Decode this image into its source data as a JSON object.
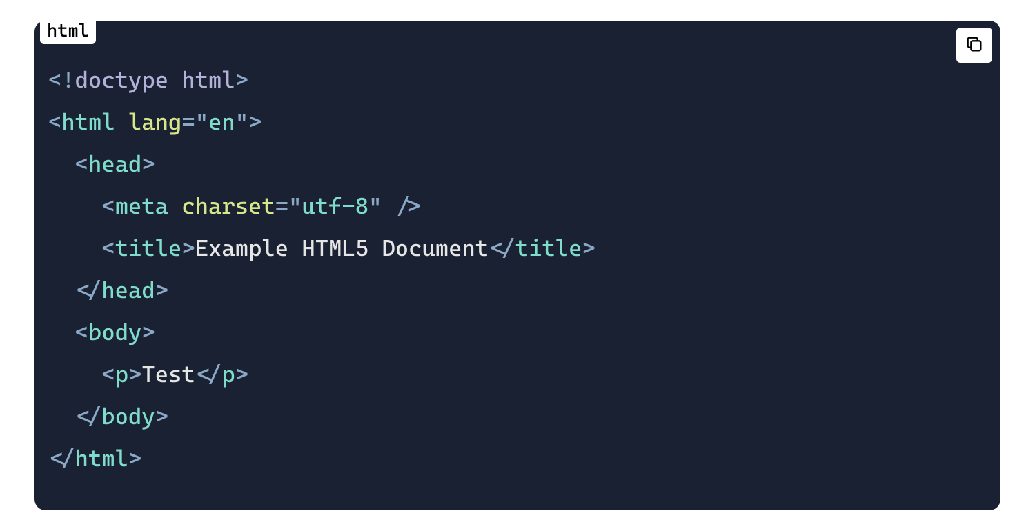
{
  "badge_label": "html",
  "code": {
    "line1": {
      "p1": "<!",
      "doctype": "doctype html",
      "p2": ">"
    },
    "line2": {
      "p1": "<",
      "tag": "html",
      "sp": " ",
      "attr": "lang",
      "eq": "=",
      "q1": "\"",
      "val": "en",
      "q2": "\"",
      "p2": ">"
    },
    "line3": {
      "indent": "  ",
      "p1": "<",
      "tag": "head",
      "p2": ">"
    },
    "line4": {
      "indent": "    ",
      "p1": "<",
      "tag": "meta",
      "sp": " ",
      "attr": "charset",
      "eq": "=",
      "q1": "\"",
      "val": "utf-8",
      "q2": "\"",
      "sp2": " ",
      "p2": "/>"
    },
    "line5": {
      "indent": "    ",
      "p1": "<",
      "tag1": "title",
      "p2": ">",
      "text": "Example HTML5 Document",
      "p3": "</",
      "tag2": "title",
      "p4": ">"
    },
    "line6": {
      "indent": "  ",
      "p1": "</",
      "tag": "head",
      "p2": ">"
    },
    "line7": {
      "indent": "  ",
      "p1": "<",
      "tag": "body",
      "p2": ">"
    },
    "line8": {
      "indent": "    ",
      "p1": "<",
      "tag1": "p",
      "p2": ">",
      "text": "Test",
      "p3": "</",
      "tag2": "p",
      "p4": ">"
    },
    "line9": {
      "indent": "  ",
      "p1": "</",
      "tag": "body",
      "p2": ">"
    },
    "line10": {
      "p1": "</",
      "tag": "html",
      "p2": ">"
    }
  }
}
